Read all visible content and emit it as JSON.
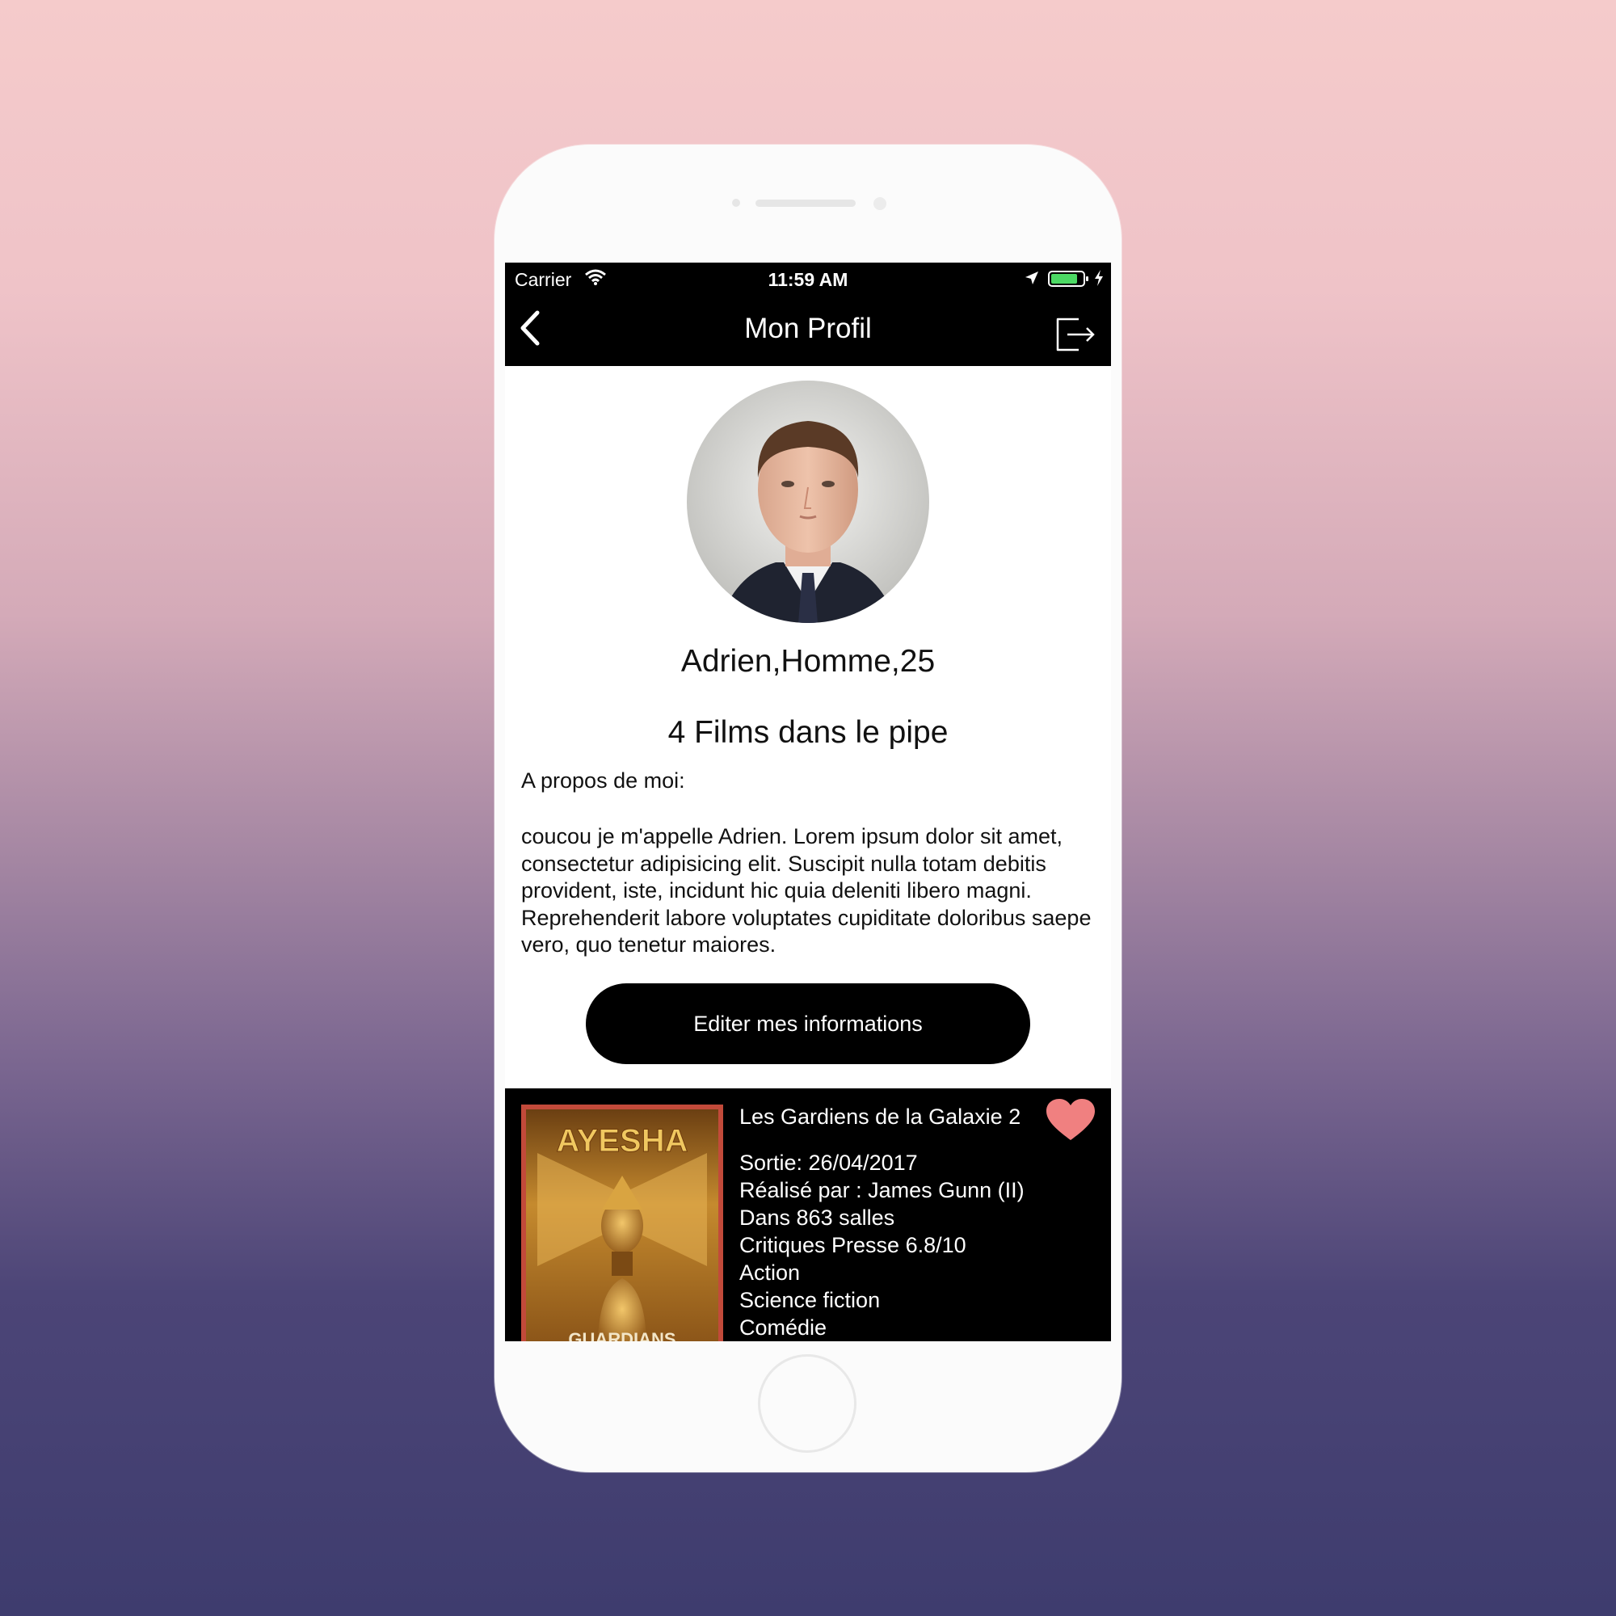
{
  "status_bar": {
    "carrier": "Carrier",
    "time": "11:59 AM",
    "icons": [
      "wifi-icon",
      "location-icon",
      "battery-icon",
      "charging-bolt-icon"
    ]
  },
  "nav": {
    "title": "Mon Profil",
    "back_icon": "chevron-left-icon",
    "logout_icon": "logout-icon"
  },
  "profile": {
    "name_line": "Adrien,Homme,25",
    "films_count": "4 Films dans le pipe",
    "about_label": "A propos de moi:",
    "about_text": "coucou je m'appelle Adrien. Lorem ipsum dolor sit amet, consectetur adipisicing elit. Suscipit nulla totam debitis provident, iste, incidunt hic quia deleniti libero magni. Reprehenderit labore voluptates cupiditate doloribus saepe vero, quo tenetur maiores.",
    "edit_button": "Editer mes informations"
  },
  "film": {
    "title": "Les Gardiens de la Galaxie 2",
    "release": "Sortie:  26/04/2017",
    "director": "Réalisé par : James Gunn (II)",
    "theaters": "Dans 863 salles",
    "press": "Critiques Presse 6.8/10",
    "genres": [
      "Action",
      "Science fiction",
      "Comédie"
    ],
    "poster_text": "AYESHA",
    "poster_bottom_text": "GUARDIANS",
    "heart_color": "#f08080"
  }
}
